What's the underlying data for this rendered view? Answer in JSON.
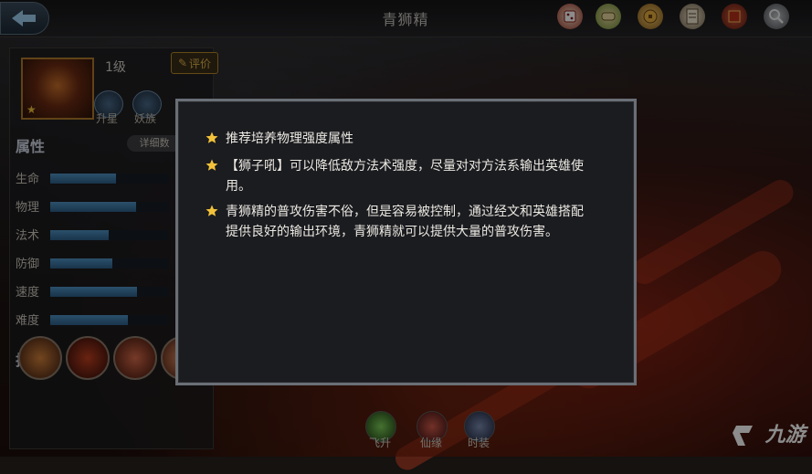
{
  "header": {
    "title": "青狮精",
    "icons": [
      "dice-icon",
      "scroll-icon",
      "coin-icon",
      "map-icon",
      "book-icon",
      "magnifier-icon"
    ]
  },
  "hero": {
    "level": "1级",
    "review_label": "评价",
    "badges": [
      {
        "label": "升星"
      },
      {
        "label": "妖族"
      }
    ]
  },
  "attributes": {
    "title": "属性",
    "detail_label": "详细数",
    "stats": [
      {
        "label": "生命",
        "value": 0.55
      },
      {
        "label": "物理",
        "value": 0.72
      },
      {
        "label": "法术",
        "value": 0.49
      },
      {
        "label": "防御",
        "value": 0.52
      },
      {
        "label": "速度",
        "value": 0.73
      },
      {
        "label": "难度",
        "value": 0.65
      }
    ]
  },
  "skills": {
    "title": "技能"
  },
  "bottom_tabs": [
    {
      "label": "飞升"
    },
    {
      "label": "仙缘"
    },
    {
      "label": "时装"
    }
  ],
  "tips": [
    "推荐培养物理强度属性",
    "【狮子吼】可以降低敌方法术强度，尽量对对方法系输出英雄使用。",
    "青狮精的普攻伤害不俗，但是容易被控制，通过经文和英雄搭配提供良好的输出环境，青狮精就可以提供大量的普攻伤害。"
  ],
  "watermark": "九游",
  "colors": {
    "accent_gold": "#f3c23a",
    "stat_bar": "#3d7aa8",
    "modal_border": "#6a6f76"
  }
}
